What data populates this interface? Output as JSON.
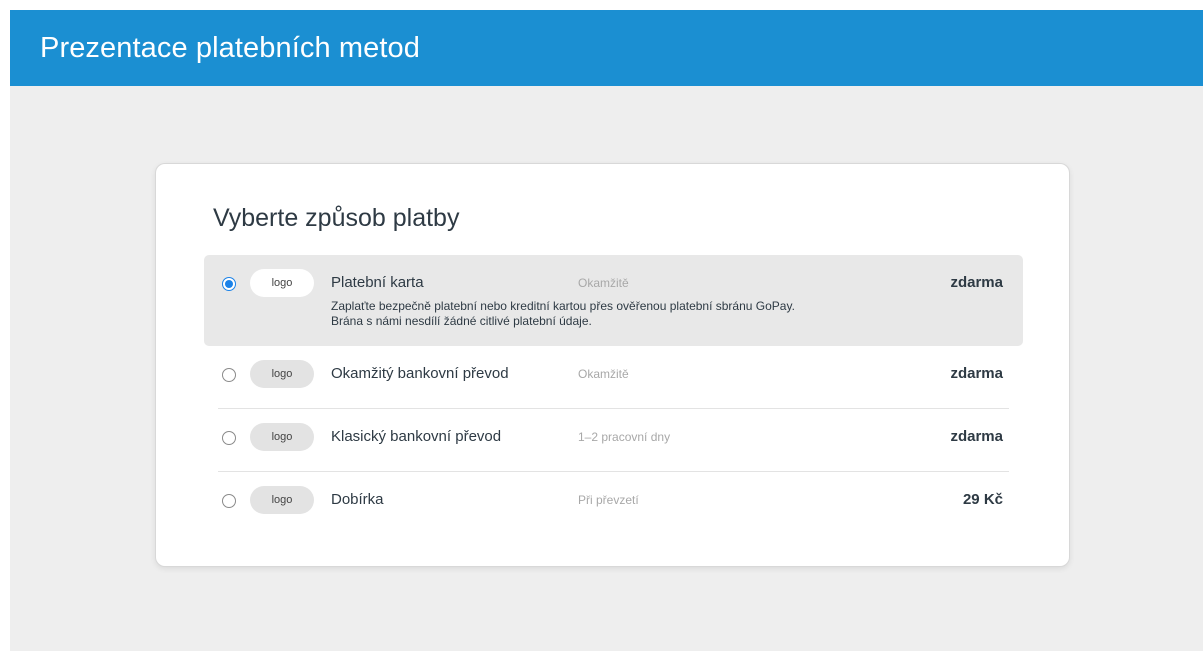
{
  "header": {
    "title": "Prezentace platebních metod"
  },
  "card": {
    "title": "Vyberte způsob platby"
  },
  "methods": [
    {
      "name": "Platební karta",
      "logo": "logo",
      "time": "Okamžitě",
      "price": "zdarma",
      "selected": true,
      "description_line1": "Zaplaťte bezpečně platební nebo kreditní kartou přes ověřenou platební sbránu GoPay.",
      "description_line2": "Brána s námi nesdílí žádné citlivé platební údaje."
    },
    {
      "name": "Okamžitý bankovní převod",
      "logo": "logo",
      "time": "Okamžitě",
      "price": "zdarma",
      "selected": false
    },
    {
      "name": "Klasický bankovní převod",
      "logo": "logo",
      "time": "1–2 pracovní dny",
      "price": "zdarma",
      "selected": false
    },
    {
      "name": "Dobírka",
      "logo": "logo",
      "time": "Při převzetí",
      "price": "29 Kč",
      "selected": false
    }
  ],
  "colors": {
    "header_bg": "#1b8fd2",
    "page_bg": "#eeeeee",
    "selected_row_bg": "#e8e8e8",
    "radio_accent": "#1b82e8",
    "text": "#2e3a44",
    "muted_text": "#a8a8a8"
  }
}
